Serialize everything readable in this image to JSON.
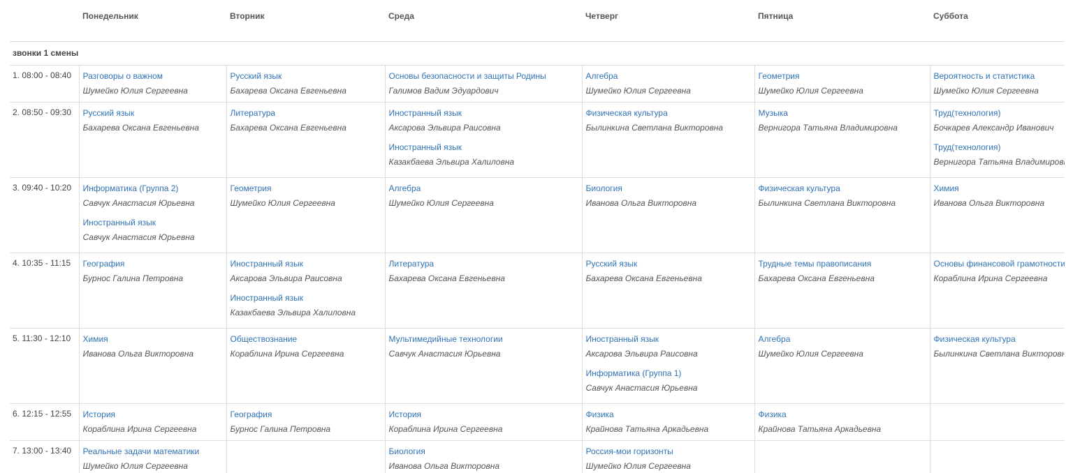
{
  "header": {
    "days": [
      "Понедельник",
      "Вторник",
      "Среда",
      "Четверг",
      "Пятница",
      "Суббота"
    ]
  },
  "shift": {
    "label": "звонки 1 смены"
  },
  "lessons": [
    {
      "time": "1. 08:00 - 08:40",
      "days": [
        [
          {
            "subject": "Разговоры о важном",
            "teacher": "Шумейко Юлия Сергеевна"
          }
        ],
        [
          {
            "subject": "Русский язык",
            "teacher": "Бахарева Оксана Евгеньевна"
          }
        ],
        [
          {
            "subject": "Основы безопасности и защиты Родины",
            "teacher": "Галимов Вадим Эдуардович"
          }
        ],
        [
          {
            "subject": "Алгебра",
            "teacher": "Шумейко Юлия Сергеевна"
          }
        ],
        [
          {
            "subject": "Геометрия",
            "teacher": "Шумейко Юлия Сергеевна"
          }
        ],
        [
          {
            "subject": "Вероятность и статистика",
            "teacher": "Шумейко Юлия Сергеевна"
          }
        ]
      ]
    },
    {
      "time": "2. 08:50 - 09:30",
      "days": [
        [
          {
            "subject": "Русский язык",
            "teacher": "Бахарева Оксана Евгеньевна"
          }
        ],
        [
          {
            "subject": "Литература",
            "teacher": "Бахарева Оксана Евгеньевна"
          }
        ],
        [
          {
            "subject": "Иностранный язык",
            "teacher": "Аксарова Эльвира Раисовна"
          },
          {
            "subject": "Иностранный язык",
            "teacher": "Казакбаева Эльвира Халиловна"
          }
        ],
        [
          {
            "subject": "Физическая культура",
            "teacher": "Былинкина Светлана Викторовна"
          }
        ],
        [
          {
            "subject": "Музыка",
            "teacher": "Вернигора Татьяна Владимировна"
          }
        ],
        [
          {
            "subject": "Труд(технология)",
            "teacher": "Бочкарев Александр Иванович"
          },
          {
            "subject": "Труд(технология)",
            "teacher": "Вернигора Татьяна Владимировна"
          }
        ]
      ]
    },
    {
      "time": "3. 09:40 - 10:20",
      "days": [
        [
          {
            "subject": "Информатика (Группа 2)",
            "teacher": "Савчук Анастасия Юрьевна"
          },
          {
            "subject": "Иностранный язык",
            "teacher": "Савчук Анастасия Юрьевна"
          }
        ],
        [
          {
            "subject": "Геометрия",
            "teacher": "Шумейко Юлия Сергеевна"
          }
        ],
        [
          {
            "subject": "Алгебра",
            "teacher": "Шумейко Юлия Сергеевна"
          }
        ],
        [
          {
            "subject": "Биология",
            "teacher": "Иванова Ольга Викторовна"
          }
        ],
        [
          {
            "subject": "Физическая культура",
            "teacher": "Былинкина Светлана Викторовна"
          }
        ],
        [
          {
            "subject": "Химия",
            "teacher": "Иванова Ольга Викторовна"
          }
        ]
      ]
    },
    {
      "time": "4. 10:35 - 11:15",
      "days": [
        [
          {
            "subject": "География",
            "teacher": "Бурнос Галина Петровна"
          }
        ],
        [
          {
            "subject": "Иностранный язык",
            "teacher": "Аксарова Эльвира Раисовна"
          },
          {
            "subject": "Иностранный язык",
            "teacher": "Казакбаева Эльвира Халиловна"
          }
        ],
        [
          {
            "subject": "Литература",
            "teacher": "Бахарева Оксана Евгеньевна"
          }
        ],
        [
          {
            "subject": "Русский язык",
            "teacher": "Бахарева Оксана Евгеньевна"
          }
        ],
        [
          {
            "subject": "Трудные темы правописания",
            "teacher": "Бахарева Оксана Евгеньевна"
          }
        ],
        [
          {
            "subject": "Основы финансовой грамотности",
            "teacher": "Кораблина Ирина Сергеевна"
          }
        ]
      ]
    },
    {
      "time": "5. 11:30 - 12:10",
      "days": [
        [
          {
            "subject": "Химия",
            "teacher": "Иванова Ольга Викторовна"
          }
        ],
        [
          {
            "subject": "Обществознание",
            "teacher": "Кораблина Ирина Сергеевна"
          }
        ],
        [
          {
            "subject": "Мультимедийные технологии",
            "teacher": "Савчук Анастасия Юрьевна"
          }
        ],
        [
          {
            "subject": "Иностранный язык",
            "teacher": "Аксарова Эльвира Раисовна"
          },
          {
            "subject": "Информатика (Группа 1)",
            "teacher": "Савчук Анастасия Юрьевна"
          }
        ],
        [
          {
            "subject": "Алгебра",
            "teacher": "Шумейко Юлия Сергеевна"
          }
        ],
        [
          {
            "subject": "Физическая культура",
            "teacher": "Былинкина Светлана Викторовна"
          }
        ]
      ]
    },
    {
      "time": "6. 12:15 - 12:55",
      "days": [
        [
          {
            "subject": "История",
            "teacher": "Кораблина Ирина Сергеевна"
          }
        ],
        [
          {
            "subject": "География",
            "teacher": "Бурнос Галина Петровна"
          }
        ],
        [
          {
            "subject": "История",
            "teacher": "Кораблина Ирина Сергеевна"
          }
        ],
        [
          {
            "subject": "Физика",
            "teacher": "Крайнова Татьяна Аркадьевна"
          }
        ],
        [
          {
            "subject": "Физика",
            "teacher": "Крайнова Татьяна Аркадьевна"
          }
        ],
        []
      ]
    },
    {
      "time": "7. 13:00 - 13:40",
      "days": [
        [
          {
            "subject": "Реальные задачи математики",
            "teacher": "Шумейко Юлия Сергеевна"
          }
        ],
        [],
        [
          {
            "subject": "Биология",
            "teacher": "Иванова Ольга Викторовна"
          }
        ],
        [
          {
            "subject": "Россия-мои горизонты",
            "teacher": "Шумейко Юлия Сергеевна"
          }
        ],
        [],
        []
      ]
    }
  ]
}
